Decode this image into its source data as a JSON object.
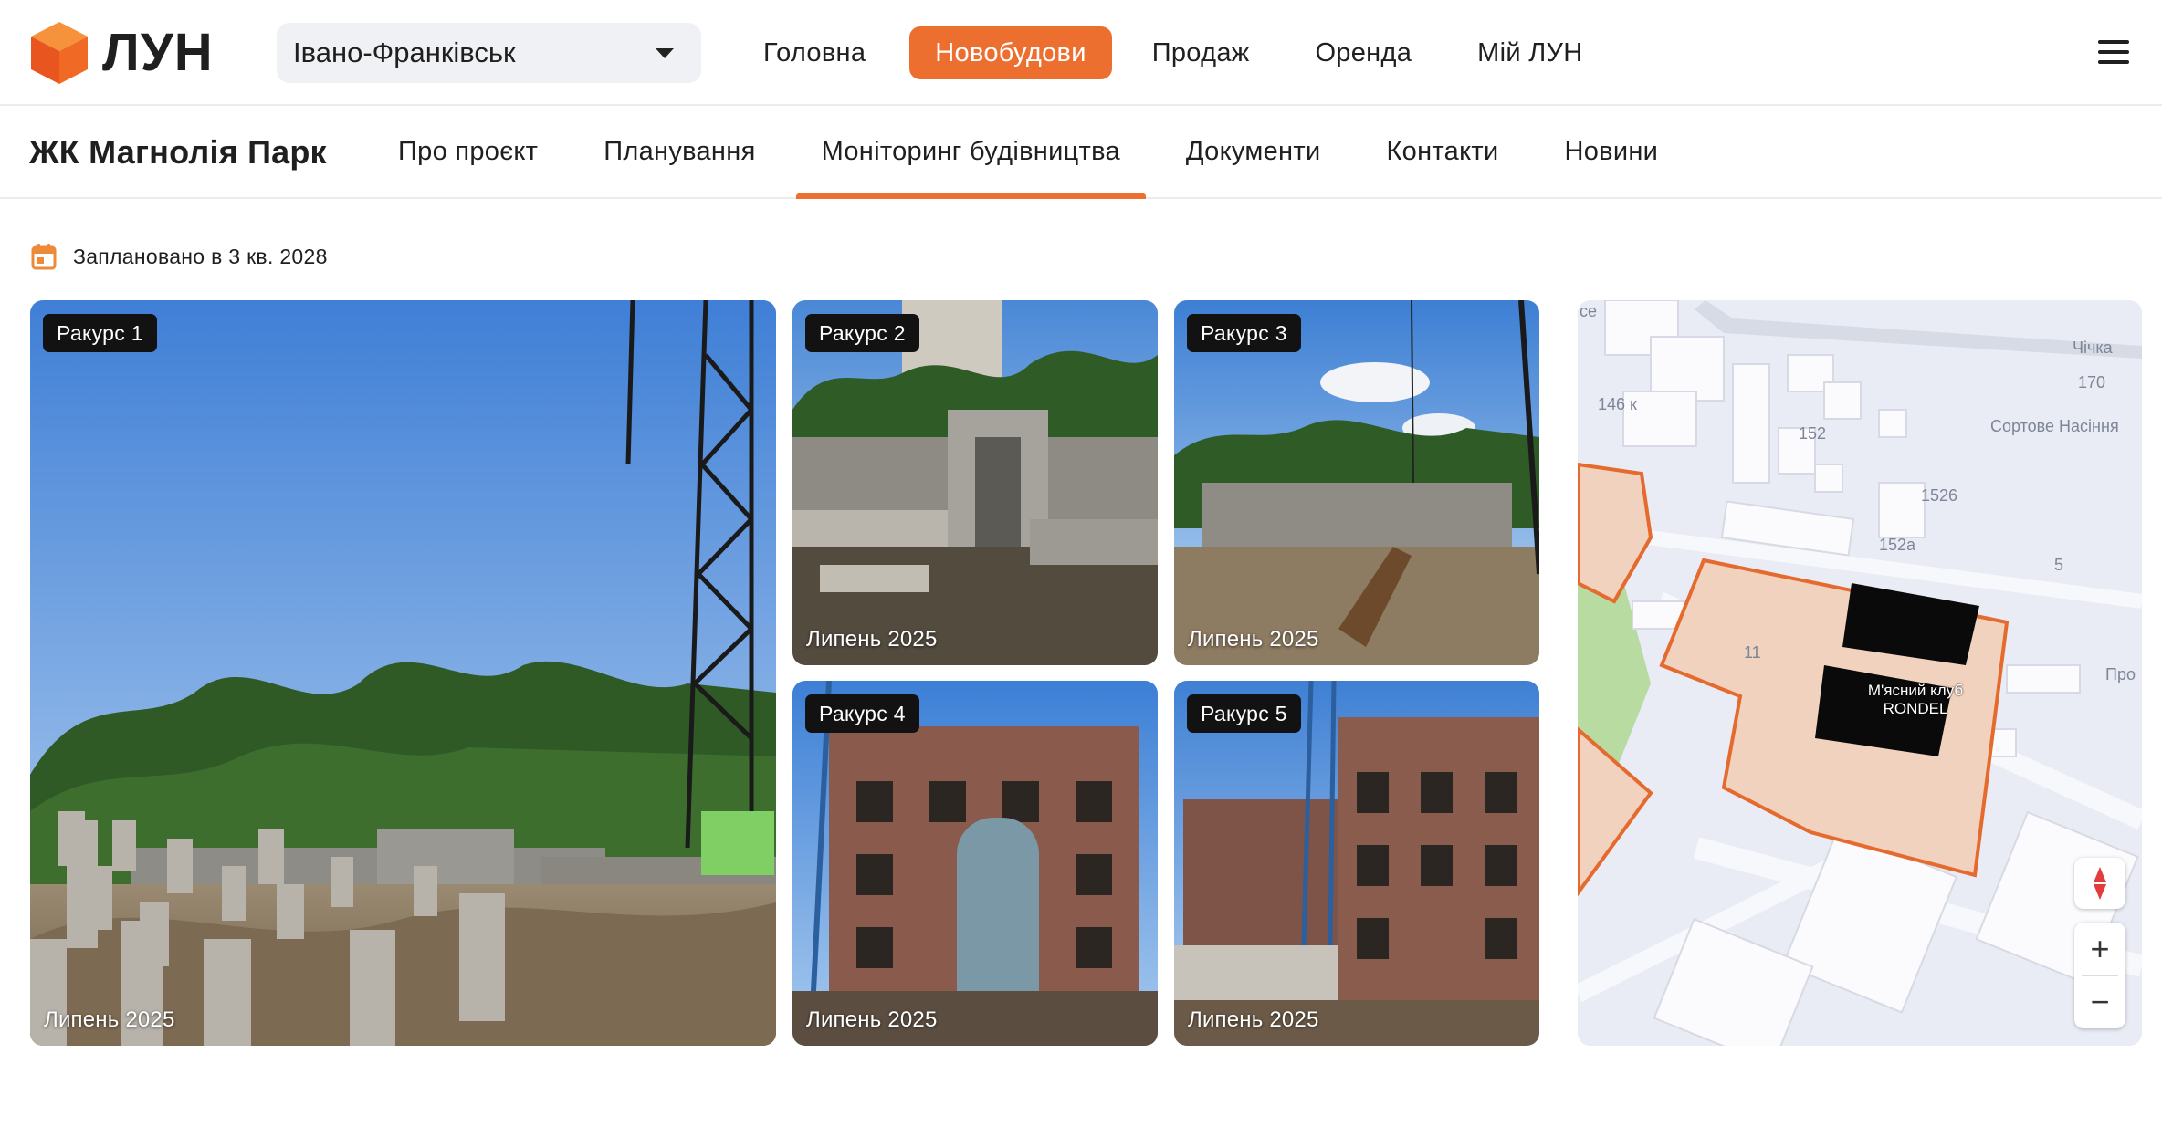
{
  "header": {
    "logo_text": "ЛУН",
    "city": "Івано-Франківськ",
    "nav": [
      {
        "label": "Головна",
        "active": false
      },
      {
        "label": "Новобудови",
        "active": true
      },
      {
        "label": "Продаж",
        "active": false
      },
      {
        "label": "Оренда",
        "active": false
      },
      {
        "label": "Мій ЛУН",
        "active": false
      }
    ],
    "accent_color": "#ed6f2f"
  },
  "project": {
    "title": "ЖК Магнолія Парк",
    "tabs": [
      {
        "label": "Про проєкт",
        "active": false
      },
      {
        "label": "Планування",
        "active": false
      },
      {
        "label": "Моніторинг будівництва",
        "active": true
      },
      {
        "label": "Документи",
        "active": false
      },
      {
        "label": "Контакти",
        "active": false
      },
      {
        "label": "Новини",
        "active": false
      }
    ]
  },
  "monitoring": {
    "planned": "Заплановано в 3 кв. 2028",
    "photos": [
      {
        "angle": "Ракурс 1",
        "date": "Липень 2025"
      },
      {
        "angle": "Ракурс 2",
        "date": "Липень 2025"
      },
      {
        "angle": "Ракурс 3",
        "date": "Липень 2025"
      },
      {
        "angle": "Ракурс 4",
        "date": "Липень 2025"
      },
      {
        "angle": "Ракурс 5",
        "date": "Липень 2025"
      }
    ]
  },
  "map": {
    "labels": {
      "ce": "ce",
      "n146": "146 к",
      "chichka": "Чічка",
      "n170": "170",
      "sortove": "Сортове Насіння",
      "n152": "152",
      "n1526": "1526",
      "n152a": "152a",
      "n5": "5",
      "n11": "11",
      "pro": "Про"
    },
    "poi": "М'ясний клуб RONDEL",
    "zoom_in": "+",
    "zoom_out": "−"
  }
}
